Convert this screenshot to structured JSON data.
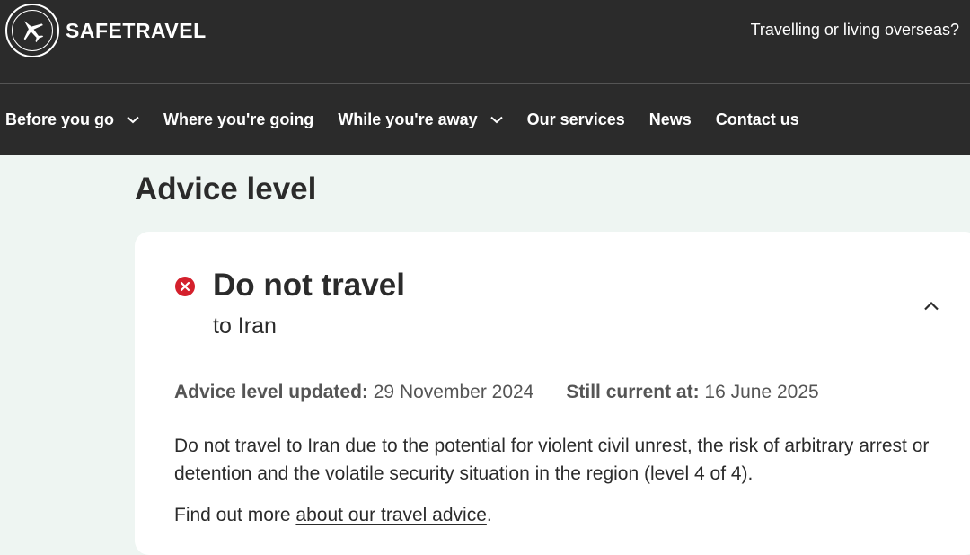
{
  "header": {
    "logo_text": "SAFETRAVEL",
    "overseas_link": "Travelling or living overseas?"
  },
  "nav": {
    "items": [
      {
        "label": "Before you go",
        "has_dropdown": true
      },
      {
        "label": "Where you're going",
        "has_dropdown": false
      },
      {
        "label": "While you're away",
        "has_dropdown": true
      },
      {
        "label": "Our services",
        "has_dropdown": false
      },
      {
        "label": "News",
        "has_dropdown": false
      },
      {
        "label": "Contact us",
        "has_dropdown": false
      }
    ]
  },
  "main": {
    "title": "Advice level",
    "card": {
      "heading": "Do not travel",
      "subheading": "to Iran",
      "status_icon": "close-circle-icon",
      "status_color": "#d4202c",
      "updated_label": "Advice level updated:",
      "updated_value": "29 November 2024",
      "current_label": "Still current at:",
      "current_value": "16 June 2025",
      "description": "Do not travel to Iran due to the potential for violent civil unrest, the risk of arbitrary arrest or detention and the volatile security situation in the region (level 4 of 4).",
      "more_prefix": "Find out more ",
      "more_link": "about our travel advice",
      "more_suffix": "."
    }
  },
  "colors": {
    "header_bg": "#2b2b2b",
    "page_bg": "#eef5f2",
    "card_bg": "#ffffff"
  }
}
